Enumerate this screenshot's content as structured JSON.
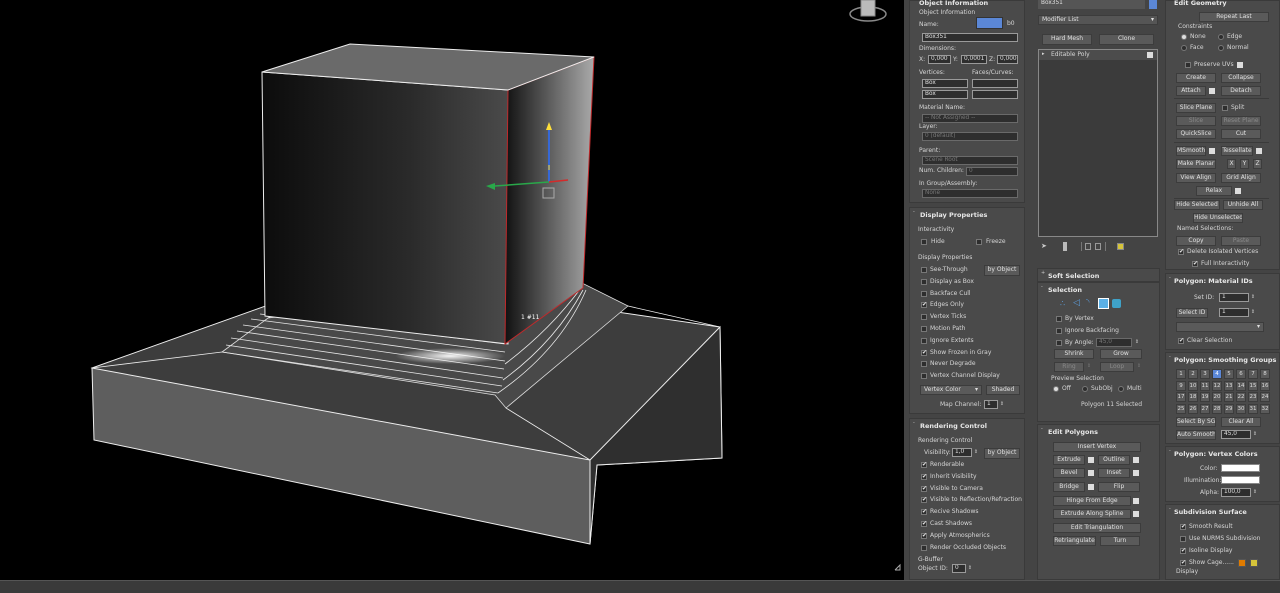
{
  "object_info": {
    "header": "Object Information",
    "sublabel": "Object Information",
    "name_label": "Name:",
    "name_suffix": "b0",
    "name_value": "Box351",
    "dimensions_label": "Dimensions:",
    "dim_x_label": "X:",
    "dim_x": "0,000",
    "dim_y_label": "Y:",
    "dim_y": "0,0001",
    "dim_z_label": "Z:",
    "dim_z": "0,000",
    "vertices_label": "Vertices:",
    "faces_label": "Faces/Curves:",
    "vertices_value_1": "Box",
    "vertices_value_2": "Box",
    "material_label": "Material Name:",
    "material_value": "-- Not Assigned --",
    "layer_label": "Layer:",
    "layer_value": "0 (default)",
    "parent_label": "Parent:",
    "parent_value": "Scene Root",
    "children_label": "Num. Children:",
    "children_value": "0",
    "group_label": "In Group/Assembly:",
    "group_value": "None"
  },
  "display_properties": {
    "header": "Display Properties",
    "interactivity_label": "Interactivity",
    "hide": "Hide",
    "freeze": "Freeze",
    "display_props_label": "Display Properties",
    "by_object": "by Object",
    "items": [
      {
        "label": "See-Through",
        "checked": false
      },
      {
        "label": "Display as Box",
        "checked": false
      },
      {
        "label": "Backface Cull",
        "checked": false
      },
      {
        "label": "Edges Only",
        "checked": true
      },
      {
        "label": "Vertex Ticks",
        "checked": false
      },
      {
        "label": "Motion Path",
        "checked": false
      },
      {
        "label": "Ignore Extents",
        "checked": false
      },
      {
        "label": "Show Frozen in Gray",
        "checked": true
      },
      {
        "label": "Never Degrade",
        "checked": false
      },
      {
        "label": "Vertex Channel Display",
        "checked": false
      }
    ],
    "vertex_color": "Vertex Color",
    "shaded": "Shaded",
    "map_channel_label": "Map Channel:",
    "map_channel_value": "1"
  },
  "rendering_control": {
    "header": "Rendering Control",
    "sublabel": "Rendering Control",
    "visibility_label": "Visibility:",
    "visibility_value": "1,0",
    "by_object": "by Object",
    "items": [
      {
        "label": "Renderable",
        "checked": true
      },
      {
        "label": "Inherit Visibility",
        "checked": true
      },
      {
        "label": "Visible to Camera",
        "checked": true
      },
      {
        "label": "Visible to Reflection/Refraction",
        "checked": true
      },
      {
        "label": "Recive Shadows",
        "checked": true
      },
      {
        "label": "Cast Shadows",
        "checked": true
      },
      {
        "label": "Apply Atmospherics",
        "checked": true
      },
      {
        "label": "Render Occluded Objects",
        "checked": false
      }
    ],
    "gbuffer_label": "G-Buffer",
    "object_id_label": "Object ID:",
    "object_id_value": "0"
  },
  "modifier": {
    "object_name": "Box351",
    "modifier_list": "Modifier List",
    "hard_mesh": "Hard Mesh",
    "clone": "Clone",
    "stack_item": "Editable Poly"
  },
  "soft_selection": {
    "header": "Soft Selection"
  },
  "selection": {
    "header": "Selection",
    "by_vertex": "By Vertex",
    "ignore_backfacing": "Ignore Backfacing",
    "by_angle": "By Angle:",
    "by_angle_value": "45,0",
    "shrink": "Shrink",
    "grow": "Grow",
    "ring": "Ring",
    "loop": "Loop",
    "preview_label": "Preview Selection",
    "off": "Off",
    "subobj": "SubObj",
    "multi": "Multi",
    "status": "Polygon 11 Selected"
  },
  "edit_polygons": {
    "header": "Edit Polygons",
    "insert_vertex": "Insert Vertex",
    "extrude": "Extrude",
    "outline": "Outline",
    "bevel": "Bevel",
    "inset": "Inset",
    "bridge": "Bridge",
    "flip": "Flip",
    "hinge": "Hinge From Edge",
    "extrude_spline": "Extrude Along Spline",
    "edit_triangulation": "Edit Triangulation",
    "retriangulate": "Retriangulate",
    "turn": "Turn"
  },
  "edit_geometry": {
    "header": "Edit Geometry",
    "repeat_last": "Repeat Last",
    "constraints_label": "Constraints",
    "none": "None",
    "edge": "Edge",
    "face": "Face",
    "normal": "Normal",
    "preserve_uvs": "Preserve UVs",
    "create": "Create",
    "collapse": "Collapse",
    "attach": "Attach",
    "detach": "Detach",
    "slice_plane": "Slice Plane",
    "split": "Split",
    "slice": "Slice",
    "reset_plane": "Reset Plane",
    "quickslice": "QuickSlice",
    "cut": "Cut",
    "msmooth": "MSmooth",
    "tessellate": "Tessellate",
    "make_planar": "Make Planar",
    "x": "X",
    "y": "Y",
    "z": "Z",
    "view_align": "View Align",
    "grid_align": "Grid Align",
    "relax": "Relax",
    "hide_selected": "Hide Selected",
    "unhide_all": "Unhide All",
    "hide_unselected": "Hide Unselected",
    "named_selections": "Named Selections:",
    "copy": "Copy",
    "paste": "Paste",
    "delete_isolated": "Delete Isolated Vertices",
    "full_interactivity": "Full Interactivity"
  },
  "material_ids": {
    "header": "Polygon: Material IDs",
    "set_id": "Set ID:",
    "set_id_value": "1",
    "select_id": "Select ID",
    "select_id_value": "1",
    "clear_selection": "Clear Selection"
  },
  "smoothing_groups": {
    "header": "Polygon: Smoothing Groups",
    "groups": [
      "1",
      "2",
      "3",
      "4",
      "5",
      "6",
      "7",
      "8",
      "9",
      "10",
      "11",
      "12",
      "13",
      "14",
      "15",
      "16",
      "17",
      "18",
      "19",
      "20",
      "21",
      "22",
      "23",
      "24",
      "25",
      "26",
      "27",
      "28",
      "29",
      "30",
      "31",
      "32"
    ],
    "active": "4",
    "select_by_sg": "Select By SG",
    "clear_all": "Clear All",
    "auto_smooth": "Auto Smooth",
    "auto_smooth_value": "45,0"
  },
  "vertex_colors": {
    "header": "Polygon: Vertex Colors",
    "color": "Color:",
    "illumination": "Illumination:",
    "alpha": "Alpha:",
    "alpha_value": "100,0"
  },
  "subdivision": {
    "header": "Subdivision Surface",
    "smooth_result": "Smooth Result",
    "use_nurms": "Use NURMS Subdivision",
    "isoline": "Isoline Display",
    "show_cage": "Show Cage......",
    "display": "Display"
  },
  "viewport": {
    "overlay_label": "1 #11"
  },
  "colors": {
    "accent": "#5b87d6",
    "cage_orange": "#e07b00",
    "cage_yellow": "#d6c43a",
    "selection_red": "#c0292b"
  }
}
